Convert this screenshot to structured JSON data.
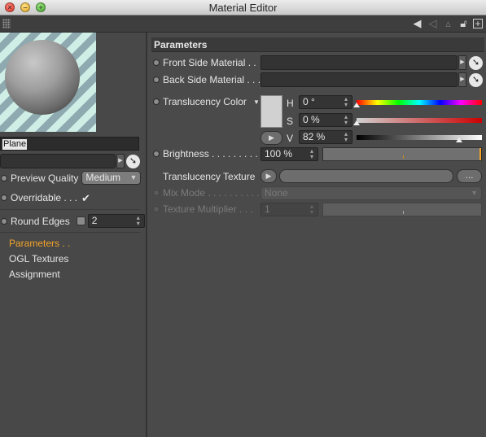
{
  "window": {
    "title": "Material Editor"
  },
  "left": {
    "name_value": "Plane",
    "preview_quality_label": "Preview Quality",
    "preview_quality_value": "Medium",
    "overridable_label": "Overridable . . .",
    "overridable_checked": true,
    "round_edges_label": "Round Edges",
    "round_edges_value": "2",
    "tabs": [
      {
        "label": "Parameters . .",
        "active": true
      },
      {
        "label": "OGL Textures",
        "active": false
      },
      {
        "label": "Assignment",
        "active": false
      }
    ]
  },
  "right": {
    "section_title": "Parameters",
    "front_side_label": "Front Side Material . .",
    "back_side_label": "Back Side Material . . .",
    "translucency_color_label": "Translucency Color",
    "color": {
      "h_label": "H",
      "h_value": "0 °",
      "s_label": "S",
      "s_value": "0 %",
      "v_label": "V",
      "v_value": "82 %",
      "v_fraction": 0.82,
      "swatch_hex": "#d1d1d1"
    },
    "brightness_label": "Brightness . . . . . . . . . .",
    "brightness_value": "100 %",
    "brightness_fraction": 1.0,
    "translucency_texture_label": "Translucency Texture",
    "texture_more_label": "...",
    "mix_mode_label": "Mix Mode . . . . . . . . . .",
    "mix_mode_value": "None",
    "texture_multiplier_label": "Texture Multiplier . . .",
    "texture_multiplier_value": "1"
  },
  "colors": {
    "accent": "#f3a32a",
    "panel": "#4a4a4a",
    "field": "#333333"
  }
}
